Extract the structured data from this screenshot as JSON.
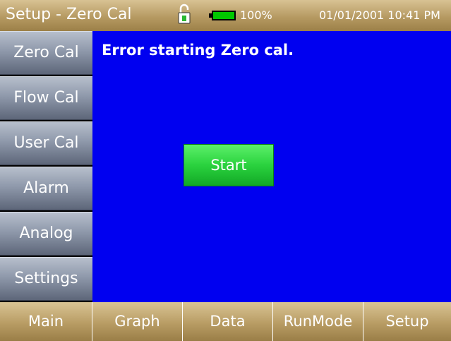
{
  "header": {
    "title": "Setup - Zero Cal",
    "lock_icon": "unlocked-padlock-icon",
    "battery_icon": "battery-icon",
    "battery_level": "100%",
    "datetime": "01/01/2001 10:41 PM",
    "battery_color": "#00c800"
  },
  "sidebar": {
    "items": [
      {
        "label": "Zero Cal"
      },
      {
        "label": "Flow Cal"
      },
      {
        "label": "User Cal"
      },
      {
        "label": "Alarm"
      },
      {
        "label": "Analog"
      },
      {
        "label": "Settings"
      }
    ]
  },
  "main": {
    "message": "Error starting Zero cal.",
    "start_label": "Start",
    "background_color": "#0000f0",
    "start_color": "#2ad23e"
  },
  "bottom_nav": {
    "items": [
      {
        "label": "Main"
      },
      {
        "label": "Graph"
      },
      {
        "label": "Data"
      },
      {
        "label": "RunMode"
      },
      {
        "label": "Setup"
      }
    ]
  }
}
